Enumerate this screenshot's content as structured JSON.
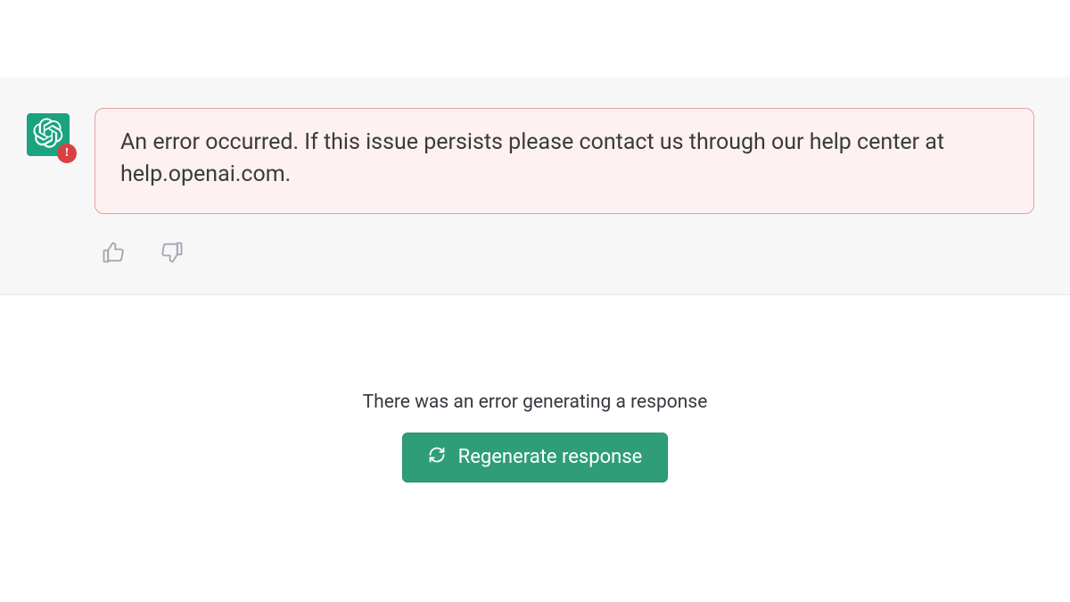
{
  "message": {
    "error_text": "An error occurred. If this issue persists please contact us through our help center at help.openai.com.",
    "error_badge_glyph": "!"
  },
  "footer": {
    "status_text": "There was an error generating a response",
    "regenerate_label": "Regenerate response"
  },
  "colors": {
    "avatar_bg": "#19a37f",
    "error_badge": "#d94141",
    "error_border": "#e6a0a0",
    "error_bg": "#fdf1f1",
    "button_bg": "#2f9e78"
  }
}
